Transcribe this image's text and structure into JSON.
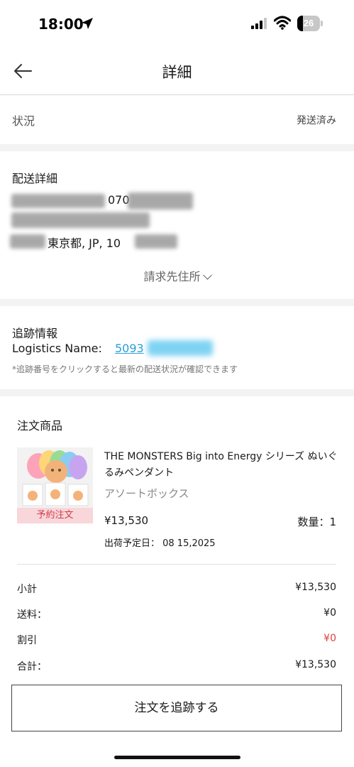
{
  "status_bar": {
    "time": "18:00",
    "battery": "26",
    "battery_level": 0.26
  },
  "header": {
    "title": "詳細"
  },
  "order_status": {
    "label": "状況",
    "value": "発送済み"
  },
  "shipping": {
    "title": "配送詳細",
    "phone_fragment": "070",
    "address_fragment": "東京都, JP, 10",
    "billing_toggle": "請求先住所"
  },
  "tracking": {
    "title": "追跡情報",
    "logistics_label": "Logistics Name:",
    "tracking_number_fragment": "5093",
    "note": "*追跡番号をクリックすると最新の配送状況が確認できます"
  },
  "order_items": {
    "title": "注文商品",
    "items": [
      {
        "name": "THE MONSTERS Big into Energy シリーズ ぬいぐるみペンダント",
        "variant": "アソートボックス",
        "price": "¥13,530",
        "quantity": "数量：1",
        "ship_date": "出荷予定日： 08 15,2025",
        "badge": "予約注文"
      }
    ]
  },
  "summary": {
    "subtotal_label": "小計",
    "subtotal_value": "¥13,530",
    "shipping_label": "送料：",
    "shipping_value": "¥0",
    "discount_label": "割引",
    "discount_value": "¥0",
    "total_label": "合計：",
    "total_value": "¥13,530"
  },
  "actions": {
    "track_order": "注文を追跡する"
  },
  "colors": {
    "link": "#2a9fd6",
    "discount": "#e04040",
    "badge_bg": "#f8d6da",
    "badge_text": "#d23b4c",
    "section_separator": "#f3f3f3"
  },
  "icons": [
    "location-arrow-icon",
    "signal-icon",
    "wifi-icon",
    "battery-icon",
    "back-arrow-icon",
    "chevron-down-icon"
  ]
}
